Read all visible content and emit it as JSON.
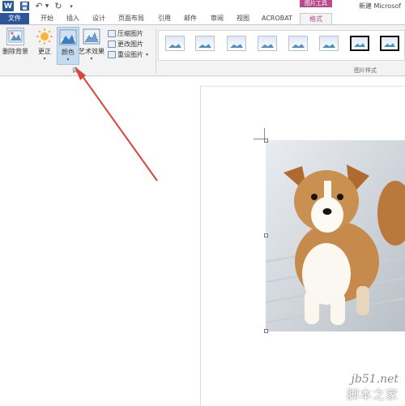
{
  "titlebar": {
    "context_tab_group": "图片工具",
    "doc_title": "新建 Microsof",
    "app_icon_label": "W",
    "undo_icon": "undo-icon",
    "redo_icon": "redo-icon"
  },
  "tabs": [
    {
      "label": "文件"
    },
    {
      "label": "开始"
    },
    {
      "label": "插入"
    },
    {
      "label": "设计"
    },
    {
      "label": "页面布局"
    },
    {
      "label": "引用"
    },
    {
      "label": "邮件"
    },
    {
      "label": "审阅"
    },
    {
      "label": "视图"
    },
    {
      "label": "ACROBAT"
    },
    {
      "label": "格式"
    }
  ],
  "ribbon": {
    "remove_bg_label": "删除背景",
    "corrections_label": "更正",
    "color_label": "颜色",
    "artistic_label": "艺术效果",
    "compress_label": "压缩图片",
    "change_label": "更改图片",
    "reset_label": "重设图片",
    "adjust_group_label": "调",
    "styles_group_label": "图片样式"
  },
  "watermark": {
    "url": "jb51.net",
    "text": "脚本之家"
  },
  "colors": {
    "word_blue": "#2b579a",
    "context_magenta": "#b94b8c",
    "arrow_red": "#d9463a"
  }
}
